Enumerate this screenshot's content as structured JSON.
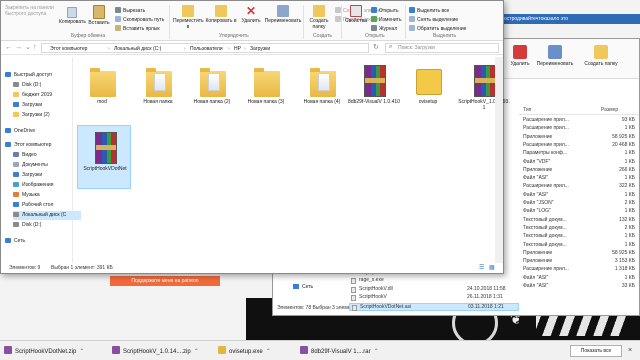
{
  "colors": {
    "accent": "#2f6bb5",
    "selection": "#cce8ff",
    "patreon": "#f26a3b",
    "folder": "#f0c75a"
  },
  "background_browser": {
    "banner_text": "остродивайтечтоказало это",
    "patreon_button": "Поддержите меня на patreon"
  },
  "window_main": {
    "ribbon": {
      "pin_label": "Закрепить на панели быстрого доступа",
      "copy_label": "Копировать",
      "paste_label": "Вставить",
      "cut_label": "Вырезать",
      "copy_path_label": "Скопировать путь",
      "paste_shortcut_label": "Вставить ярлык",
      "move_to_label": "Переместить в",
      "copy_to_label": "Копировать в",
      "delete_label": "Удалить",
      "rename_label": "Переименовать",
      "new_folder_label": "Создать папку",
      "new_item_label": "Создать элемент",
      "easy_access_label": "Простой доступ",
      "properties_label": "Свойства",
      "open_label": "Открыть",
      "edit_label": "Изменить",
      "history_label": "Журнал",
      "select_all_label": "Выделить все",
      "select_none_label": "Снять выделение",
      "invert_selection_label": "Обратить выделение",
      "group_clipboard": "Буфер обмена",
      "group_organize": "Упорядочить",
      "group_create": "Создать",
      "group_open": "Открыть",
      "group_select": "Выделить"
    },
    "address": {
      "crumbs": [
        "Этот компьютер",
        "Локальный диск (C:)",
        "Пользователи",
        "HP",
        "Загрузки"
      ],
      "search_placeholder": "Поиск: Загрузки"
    },
    "sidebar": [
      {
        "label": "Быстрый доступ",
        "icon": "star-icon"
      },
      {
        "label": "Disk (D:)",
        "icon": "drive-icon"
      },
      {
        "label": "бюджет 2019",
        "icon": "folder-icon"
      },
      {
        "label": "Загрузки",
        "icon": "download-icon"
      },
      {
        "label": "Загрузки (2)",
        "icon": "folder-icon"
      },
      {
        "label": "OneDrive",
        "icon": "cloud-icon"
      },
      {
        "label": "Этот компьютер",
        "icon": "computer-icon"
      },
      {
        "label": "Видео",
        "icon": "video-icon"
      },
      {
        "label": "Документы",
        "icon": "documents-icon"
      },
      {
        "label": "Загрузки",
        "icon": "download-icon"
      },
      {
        "label": "Изображения",
        "icon": "pictures-icon"
      },
      {
        "label": "Музыка",
        "icon": "music-icon"
      },
      {
        "label": "Рабочий стол",
        "icon": "desktop-icon"
      },
      {
        "label": "Локальный диск (C",
        "icon": "drive-icon"
      },
      {
        "label": "Disk (D:)",
        "icon": "drive-icon"
      },
      {
        "label": "Сеть",
        "icon": "network-icon"
      }
    ],
    "files": [
      {
        "name": "mod",
        "type": "folder"
      },
      {
        "name": "Новая папка",
        "type": "folder-docs"
      },
      {
        "name": "Новая папка (2)",
        "type": "folder-docs"
      },
      {
        "name": "Новая папка (3)",
        "type": "folder"
      },
      {
        "name": "Новая папка (4)",
        "type": "folder-docs"
      },
      {
        "name": "8db29f-VisualV 1.0.410",
        "type": "rar"
      },
      {
        "name": "ovisetup",
        "type": "setup"
      },
      {
        "name": "ScriptHookV_1.0.1493.1",
        "type": "rar"
      },
      {
        "name": "ScriptHookVDotNet",
        "type": "rar"
      }
    ],
    "status": {
      "count": "Элементов: 9",
      "selected": "Выбран 1 элемент: 391 КБ"
    }
  },
  "window_back": {
    "ribbon": {
      "delete_label": "Удалить",
      "rename_label": "Переименовать",
      "new_folder_label": "Создать папку"
    },
    "columns": {
      "type": "Тип",
      "size": "Размер"
    },
    "rows": [
      {
        "type": "Расширение прил...",
        "size": "93 КБ"
      },
      {
        "type": "Расширение прил...",
        "size": "1 КБ"
      },
      {
        "type": "Приложение",
        "size": "58 925 КБ"
      },
      {
        "type": "Расширение прил...",
        "size": "20 468 КБ"
      },
      {
        "type": "Параметры конф...",
        "size": "1 КБ"
      },
      {
        "type": "Файл \"VDF\"",
        "size": "1 КБ"
      },
      {
        "type": "Приложение",
        "size": "266 КБ"
      },
      {
        "type": "Файл \"ASI\"",
        "size": "1 КБ"
      },
      {
        "type": "Расширение прил...",
        "size": "322 КБ"
      },
      {
        "type": "Файл \"ASI\"",
        "size": "1 КБ"
      },
      {
        "type": "Файл \"JSON\"",
        "size": "2 КБ"
      },
      {
        "type": "Файл \"LOG\"",
        "size": "1 КБ"
      },
      {
        "type": "Текстовый докум...",
        "size": "132 КБ"
      },
      {
        "type": "Текстовый докум...",
        "size": "2 КБ"
      },
      {
        "type": "Текстовый докум...",
        "size": "1 КБ"
      },
      {
        "type": "Текстовый докум...",
        "size": "1 КБ"
      },
      {
        "type": "Приложение",
        "size": "58 925 КБ"
      },
      {
        "type": "Приложение",
        "size": "3 153 КБ"
      },
      {
        "type": "Расширение прил...",
        "size": "1 318 КБ"
      },
      {
        "type": "Файл \"ASI\"",
        "size": "1 КБ"
      },
      {
        "type": "Файл \"ASI\"",
        "size": "33 КБ"
      }
    ],
    "list_files": [
      {
        "name": "rage_s.exe",
        "date": ""
      },
      {
        "name": "ScriptHookV.dll",
        "date": "24.10.2018 11:58"
      },
      {
        "name": "ScriptHookV",
        "date": "26.11.2018 1:31"
      },
      {
        "name": "ScriptHookVDotNet.asi",
        "date": "03.11.2018 1:21"
      }
    ],
    "drive_label": "ЗЖИ (D:)",
    "network_label": "Сеть",
    "status": "Элементов: 78   Выбран 3 элемента: 1,07 МБ"
  },
  "taskbar": {
    "items": [
      {
        "label": "ScriptHookVDotNet.zip",
        "icon": "archive-icon"
      },
      {
        "label": "ScriptHookV_1.0.14....zip",
        "icon": "archive-icon"
      },
      {
        "label": "ovisetup.exe",
        "icon": "installer-icon"
      },
      {
        "label": "8db29f-VisualV 1....rar",
        "icon": "archive-icon"
      }
    ],
    "show_all": "Показать все",
    "close": "×"
  }
}
